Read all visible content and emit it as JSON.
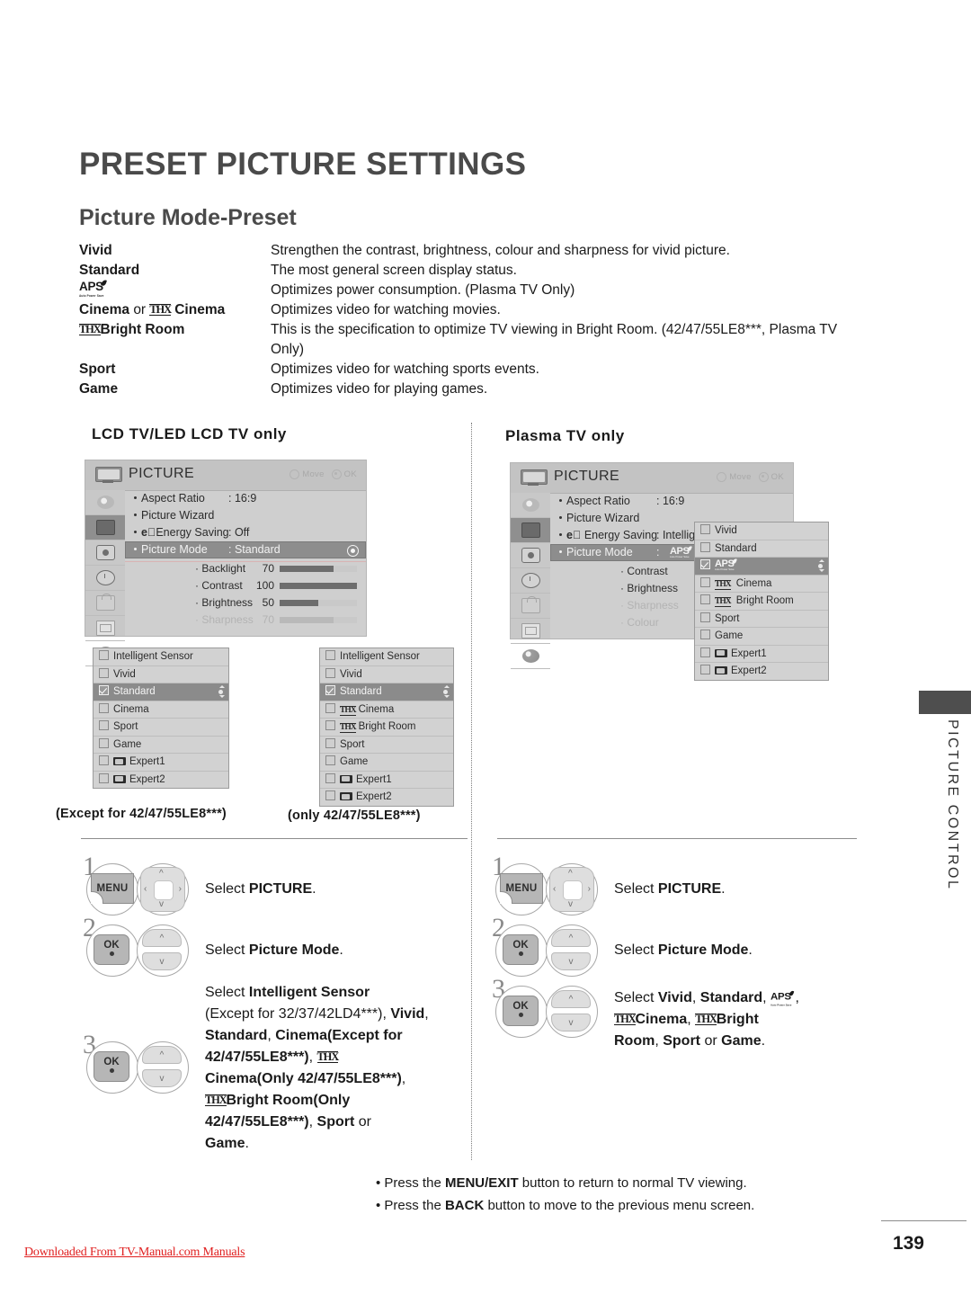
{
  "page": {
    "title": "PRESET PICTURE SETTINGS",
    "subtitle": "Picture Mode-Preset",
    "page_number": "139",
    "watermark": "Downloaded From TV-Manual.com Manuals",
    "side_tab_label": "PICTURE CONTROL"
  },
  "modes": [
    {
      "term": "Vivid",
      "desc": "Strengthen the contrast, brightness, colour and sharpness for vivid picture."
    },
    {
      "term": "Standard",
      "desc": "The most general screen display status."
    },
    {
      "term_icon": "aps-icon",
      "term": "",
      "desc": "Optimizes power consumption. (Plasma TV Only)"
    },
    {
      "term": "Cinema or ⦀THX⦀ Cinema",
      "desc": "Optimizes video for watching movies."
    },
    {
      "term": "⦀THX⦀Bright Room",
      "desc": "This is the specification to optimize TV viewing in Bright Room. (42/47/55LE8***, Plasma TV Only)"
    },
    {
      "term": "Sport",
      "desc": "Optimizes video for watching sports events."
    },
    {
      "term": "Game",
      "desc": "Optimizes video for playing games."
    }
  ],
  "sections": {
    "lcd_caption": "LCD TV/LED LCD TV only",
    "plasma_caption": "Plasma TV only"
  },
  "osd": {
    "hint_move": "Move",
    "hint_ok": "OK",
    "title": "PICTURE",
    "rail_icons": [
      "setup-icon",
      "picture-icon",
      "audio-icon",
      "time-icon",
      "lock-icon",
      "option-icon",
      "network-icon"
    ],
    "lcd": {
      "rows": [
        {
          "label": "Aspect Ratio",
          "value": ": 16:9"
        },
        {
          "label": "Picture Wizard",
          "value": ""
        },
        {
          "label": "Energy Saving",
          "value": ": Off",
          "icon": "eco-icon"
        },
        {
          "label": "Picture Mode",
          "value": ": Standard",
          "selected": true
        }
      ],
      "sliders": [
        {
          "label": "Backlight",
          "value": "70",
          "pct": 70
        },
        {
          "label": "Contrast",
          "value": "100",
          "pct": 100
        },
        {
          "label": "Brightness",
          "value": "50",
          "pct": 50
        },
        {
          "label": "Sharpness",
          "value": "70",
          "pct": 70,
          "dim": true
        }
      ]
    },
    "plasma": {
      "rows": [
        {
          "label": "Aspect Ratio",
          "value": ": 16:9"
        },
        {
          "label": "Picture Wizard",
          "value": ""
        },
        {
          "label": "Energy Saving",
          "value": ": Intelligent Se",
          "icon": "eco-icon"
        },
        {
          "label": "Picture Mode",
          "value": ":",
          "value_icon": "aps-icon",
          "selected": true
        }
      ],
      "sliders": [
        {
          "label": "Contrast",
          "value": ""
        },
        {
          "label": "Brightness",
          "value": ""
        },
        {
          "label": "Sharpness",
          "value": "",
          "dim": true
        },
        {
          "label": "Colour",
          "value": "",
          "dim": true
        }
      ]
    }
  },
  "dropdowns": {
    "lcd_a": {
      "caption": "(Except for 42/47/55LE8***)",
      "items": [
        {
          "label": "Intelligent Sensor"
        },
        {
          "label": "Vivid"
        },
        {
          "label": "Standard",
          "checked": true
        },
        {
          "label": "Cinema"
        },
        {
          "label": "Sport"
        },
        {
          "label": "Game"
        },
        {
          "label": "Expert1",
          "icon": "expert-icon"
        },
        {
          "label": "Expert2",
          "icon": "expert-icon"
        }
      ]
    },
    "lcd_b": {
      "caption": "(only 42/47/55LE8***)",
      "items": [
        {
          "label": "Intelligent Sensor"
        },
        {
          "label": "Vivid"
        },
        {
          "label": "Standard",
          "checked": true
        },
        {
          "label": "Cinema",
          "icon": "thx-icon"
        },
        {
          "label": "Bright Room",
          "icon": "thx-icon"
        },
        {
          "label": "Sport"
        },
        {
          "label": "Game"
        },
        {
          "label": "Expert1",
          "icon": "expert-icon"
        },
        {
          "label": "Expert2",
          "icon": "expert-icon"
        }
      ]
    },
    "plasma": {
      "items": [
        {
          "label": "Vivid"
        },
        {
          "label": "Standard"
        },
        {
          "label": "",
          "icon": "aps-icon",
          "checked": true
        },
        {
          "label": "Cinema",
          "icon": "thx-icon"
        },
        {
          "label": "Bright Room",
          "icon": "thx-icon"
        },
        {
          "label": "Sport"
        },
        {
          "label": "Game"
        },
        {
          "label": "Expert1",
          "icon": "expert-icon"
        },
        {
          "label": "Expert2",
          "icon": "expert-icon"
        }
      ]
    }
  },
  "steps_left": [
    {
      "num": "1",
      "buttons": [
        "menu-button",
        "dpad-button"
      ],
      "text_prefix": "Select ",
      "text_bold": "PICTURE",
      "text_suffix": "."
    },
    {
      "num": "2",
      "buttons": [
        "ok-button",
        "rocker-button"
      ],
      "text_prefix": "Select ",
      "text_bold": "Picture Mode",
      "text_suffix": "."
    },
    {
      "num": "3",
      "buttons": [
        "ok-button",
        "rocker-button"
      ],
      "text_long": "Select Intelligent Sensor (Except for 32/37/42LD4***), Vivid, Standard, Cinema(Except for 42/47/55LE8***), THX Cinema(Only 42/47/55LE8***), THX Bright Room(Only 42/47/55LE8***), Sport or Game."
    }
  ],
  "steps_right": [
    {
      "num": "1",
      "buttons": [
        "menu-button",
        "dpad-button"
      ],
      "text_prefix": "Select ",
      "text_bold": "PICTURE",
      "text_suffix": "."
    },
    {
      "num": "2",
      "buttons": [
        "ok-button",
        "rocker-button"
      ],
      "text_prefix": "Select ",
      "text_bold": "Picture Mode",
      "text_suffix": "."
    },
    {
      "num": "3",
      "buttons": [
        "ok-button",
        "rocker-button"
      ],
      "text_long": "Select Vivid, Standard, APS, THX Cinema, THX Bright Room, Sport or Game."
    }
  ],
  "step_labels": {
    "menu": "MENU",
    "ok": "OK"
  },
  "notes": [
    {
      "pre": "• Press the ",
      "b": "MENU/EXIT",
      "post": " button to return to normal TV viewing."
    },
    {
      "pre": "• Press the ",
      "b": "BACK",
      "post": " button to move to the previous menu screen."
    }
  ]
}
